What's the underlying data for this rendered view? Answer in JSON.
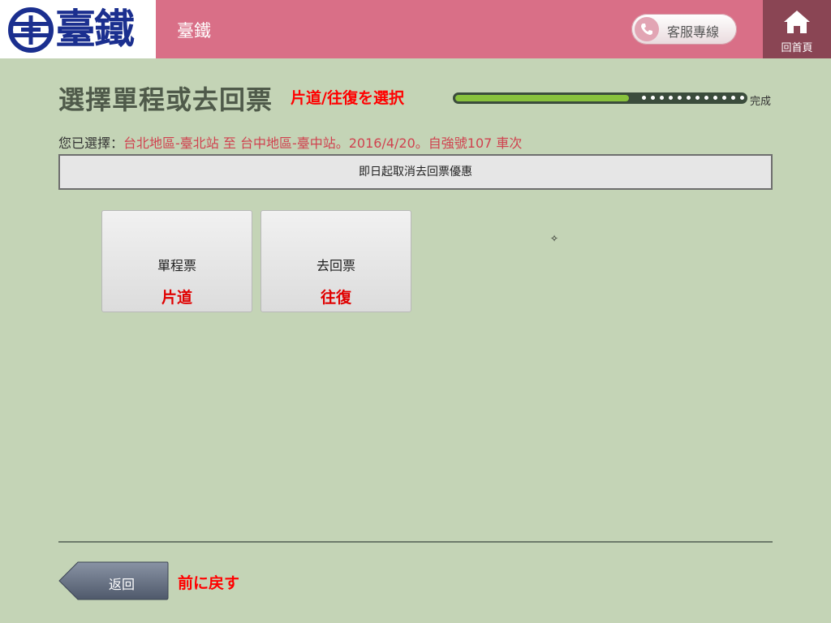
{
  "header": {
    "logo_text": "臺鐵",
    "app_title": "臺鐵",
    "hotline_label": "客服專線",
    "home_label": "回首頁",
    "colors": {
      "bar": "#d96f87",
      "home": "#8a4554",
      "logo": "#1b2f8f"
    }
  },
  "page": {
    "title": "選擇單程或去回票",
    "title_jp": "片道/往復を選択",
    "progress": {
      "fraction": 0.6,
      "end_label": "完成"
    },
    "summary_label": "您已選擇：",
    "summary_value": "台北地區-臺北站 至 台中地區-臺中站。2016/4/20。自強號107 車次",
    "notice": "即日起取消去回票優惠"
  },
  "options": [
    {
      "label": "單程票",
      "label_jp": "片道"
    },
    {
      "label": "去回票",
      "label_jp": "往復"
    }
  ],
  "footer": {
    "back_label": "返回",
    "back_jp": "前に戻す"
  },
  "icons": [
    "logo-mark-icon",
    "phone-icon",
    "home-icon",
    "back-arrow-icon"
  ]
}
